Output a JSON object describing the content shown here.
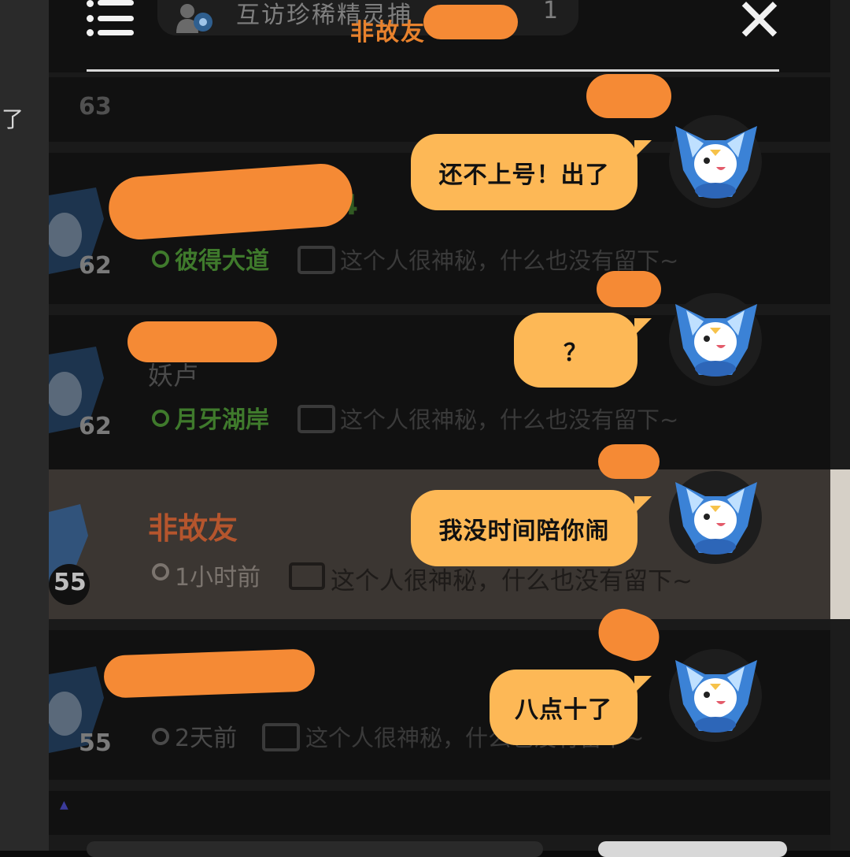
{
  "left_edge_text": "了",
  "header": {
    "visit_text": "互访珍稀精灵捕",
    "visit_count": "1",
    "title": "非故友"
  },
  "friends": [
    {
      "level": "62",
      "location": "彼得大道",
      "bio": "这个人很神秘，什么也没有留下~",
      "name_partial": "4"
    },
    {
      "level": "62",
      "location": "月牙湖岸",
      "bio": "这个人很神秘，什么也没有留下~",
      "name_partial": "妖卢"
    },
    {
      "level": "55",
      "name": "非故友",
      "time": "1小时前",
      "bio": "这个人很神秘，什么也没有留下~"
    },
    {
      "level": "55",
      "time": "2天前",
      "bio": "这个人很神秘，什么也没有留下~"
    }
  ],
  "top_partial_level": "63",
  "messages": [
    {
      "text": "还不上号！出了"
    },
    {
      "text": "？"
    },
    {
      "text": "我没时间陪你闹"
    },
    {
      "text": "八点十了"
    }
  ],
  "colors": {
    "accent": "#e8822d",
    "bubble": "#fdb856",
    "redaction": "#f58a35",
    "location_green": "#3f7a2c",
    "highlight_row": "#3b3632"
  }
}
